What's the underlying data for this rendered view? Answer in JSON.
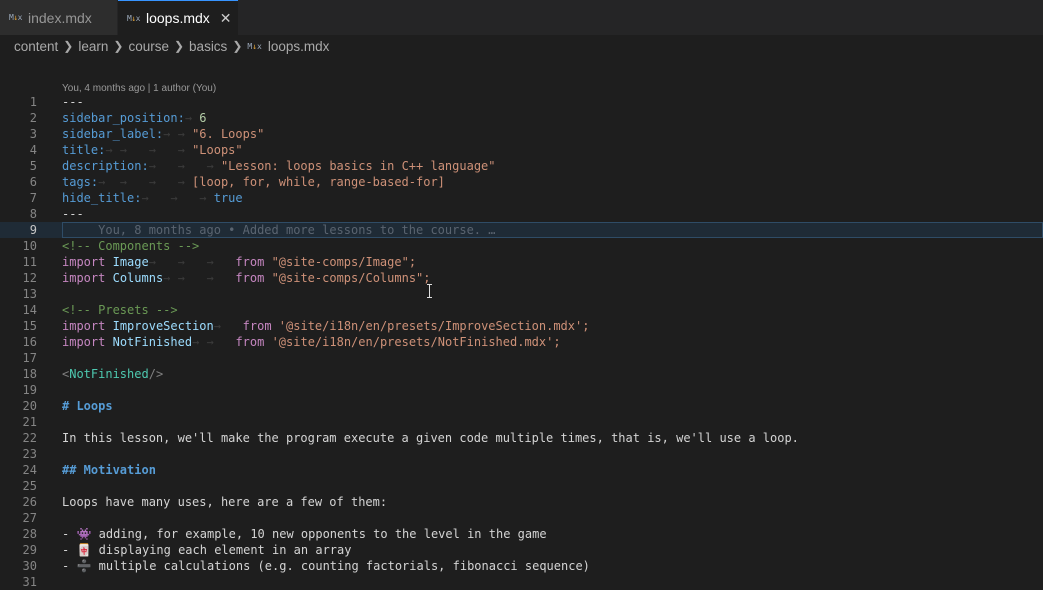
{
  "tabs": [
    {
      "label": "index.mdx",
      "icon": "mdx-file-icon",
      "active": false
    },
    {
      "label": "loops.mdx",
      "icon": "mdx-file-icon",
      "active": true
    }
  ],
  "breadcrumb": [
    "content",
    "learn",
    "course",
    "basics",
    "loops.mdx"
  ],
  "blame_header": "You, 4 months ago | 1 author (You)",
  "inline_blame": "You, 8 months ago • Added more lessons to the course. …",
  "lines": {
    "l2_key": "sidebar_position:",
    "l2_val": "6",
    "l3_key": "sidebar_label:",
    "l3_val": "\"6. Loops\"",
    "l4_key": "title:",
    "l4_val": "\"Loops\"",
    "l5_key": "description:",
    "l5_val": "\"Lesson: loops basics in C++ language\"",
    "l6_key": "tags:",
    "l6_val": "[loop, for, while, range-based-for]",
    "l7_key": "hide_title:",
    "l7_val": "true",
    "dashes": "---",
    "l10": "<!-- Components -->",
    "import": "import",
    "from": "from",
    "l11_name": "Image",
    "l11_path": "\"@site-comps/Image\";",
    "l12_name": "Columns",
    "l12_path": "\"@site-comps/Columns\";",
    "l14": "<!-- Presets -->",
    "l15_name": "ImproveSection",
    "l15_path": "'@site/i18n/en/presets/ImproveSection.mdx';",
    "l16_name": "NotFinished",
    "l16_path": "'@site/i18n/en/presets/NotFinished.mdx';",
    "l18_open": "<",
    "l18_tag": "NotFinished",
    "l18_close": "/>",
    "l20": "# Loops",
    "l22": "In this lesson, we'll make the program execute a given code multiple times, that is, we'll use a loop.",
    "l24": "## Motivation",
    "l26": "Loops have many uses, here are a few of them:",
    "l28": "- 👾 adding, for example, 10 new opponents to the level in the game",
    "l29": "- 🀄 displaying each element in an array",
    "l30": "- ➗ multiple calculations (e.g. counting factorials, fibonacci sequence)"
  },
  "line_numbers": [
    "1",
    "2",
    "3",
    "4",
    "5",
    "6",
    "7",
    "8",
    "9",
    "10",
    "11",
    "12",
    "13",
    "14",
    "15",
    "16",
    "17",
    "18",
    "19",
    "20",
    "21",
    "22",
    "23",
    "24",
    "25",
    "26",
    "27",
    "28",
    "29",
    "30",
    "31"
  ]
}
